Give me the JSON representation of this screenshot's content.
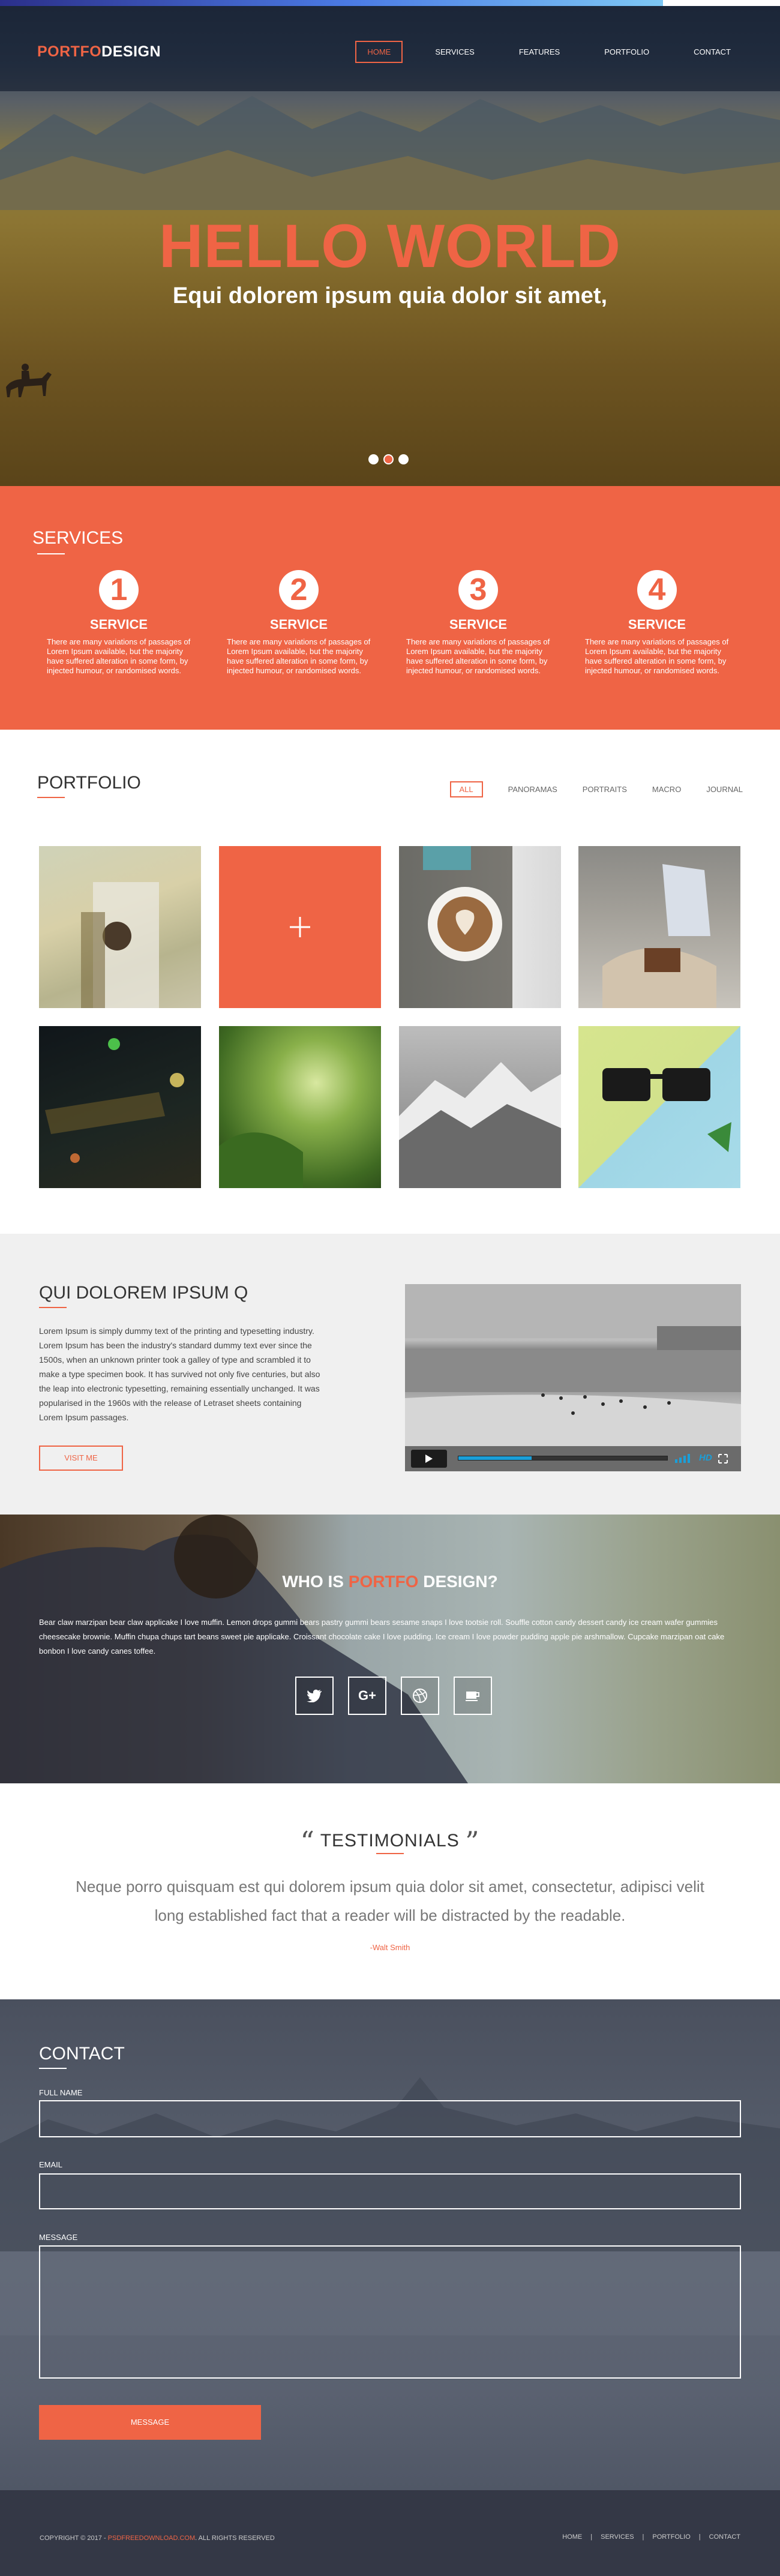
{
  "brand": {
    "part1": "PORTFO",
    "part2": "DESIGN"
  },
  "nav": [
    "HOME",
    "SERVICES",
    "FEATURES",
    "PORTFOLIO",
    "CONTACT"
  ],
  "hero": {
    "title": "HELLO WORLD",
    "subtitle": "Equi dolorem ipsum quia dolor sit amet,"
  },
  "services": {
    "title": "SERVICES",
    "items": [
      {
        "num": "1",
        "name": "SERVICE",
        "text": "There are many variations of passages of Lorem Ipsum available, but the majority have suffered alteration in some form, by injected humour, or randomised words."
      },
      {
        "num": "2",
        "name": "SERVICE",
        "text": "There are many variations of passages of Lorem Ipsum available, but the majority have suffered alteration in some form, by injected humour, or randomised words."
      },
      {
        "num": "3",
        "name": "SERVICE",
        "text": "There are many variations of passages of Lorem Ipsum available, but the majority have suffered alteration in some form, by injected humour, or randomised words."
      },
      {
        "num": "4",
        "name": "SERVICE",
        "text": "There are many variations of passages of Lorem Ipsum available, but the majority have suffered alteration in some form, by injected humour, or randomised words."
      }
    ]
  },
  "portfolio": {
    "title": "PORTFOLIO",
    "filters": [
      "ALL",
      "PANORAMAS",
      "PORTRAITS",
      "MACRO",
      "JOURNAL"
    ],
    "add_icon": "plus-icon"
  },
  "about": {
    "title": "QUI DOLOREM IPSUM Q",
    "text": "Lorem Ipsum is simply dummy text of the printing and typesetting industry. Lorem Ipsum has been the industry's standard dummy text ever since the 1500s, when an unknown printer took a galley of type and scrambled it to make a type specimen book. It has survived not only five centuries, but also the leap into electronic typesetting, remaining essentially unchanged. It was popularised in the 1960s with the release of Letraset sheets containing Lorem Ipsum passages.",
    "button": "VISIT ME",
    "video_hd": "HD",
    "video_progress": 0.35
  },
  "who": {
    "title_part1": "WHO IS ",
    "title_part2": "PORTFO",
    "title_part3": " DESIGN?",
    "text": "Bear claw marzipan bear claw applicake I love muffin. Lemon drops gummi bears pastry gummi bears sesame snaps I love tootsie roll. Souffle cotton candy dessert candy ice cream wafer gummies cheesecake brownie. Muffin chupa chups tart beans sweet pie applicake. Croissant chocolate cake I love pudding. Ice cream I love powder pudding apple pie arshmallow. Cupcake marzipan oat cake bonbon I love candy canes toffee.",
    "social": [
      {
        "icon": "twitter-icon",
        "glyph": "🐦"
      },
      {
        "icon": "google-plus-icon",
        "glyph": "G+"
      },
      {
        "icon": "dribbble-icon",
        "glyph": "◎"
      },
      {
        "icon": "coffee-icon",
        "glyph": "☕"
      }
    ]
  },
  "testimonials": {
    "title": "TESTIMONIALS",
    "quote_open": "“",
    "quote_close": "”",
    "text_line1": "Neque porro quisquam est qui dolorem ipsum quia dolor sit amet, consectetur, adipisci velit",
    "text_line2": "long established fact that a reader will be distracted by the readable.",
    "author": "-Walt Smith"
  },
  "contact": {
    "title": "CONTACT",
    "labels": {
      "name": "FULL NAME",
      "email": "EMAIL",
      "message": "MESSAGE"
    },
    "values": {
      "name": "",
      "email": "",
      "message": ""
    },
    "button": "MESSAGE"
  },
  "footer": {
    "copy_prefix": "COPYRIGHT © 2017 - ",
    "copy_link": "PSDFREEDOWNLOAD.COM",
    "copy_suffix": ". ALL RIGHTS RESERVED",
    "nav": [
      "HOME",
      "SERVICES",
      "PORTFOLIO",
      "CONTACT"
    ]
  },
  "colors": {
    "accent": "#ef6445",
    "dark": "#343846",
    "light_bg": "#f0f0f0"
  }
}
